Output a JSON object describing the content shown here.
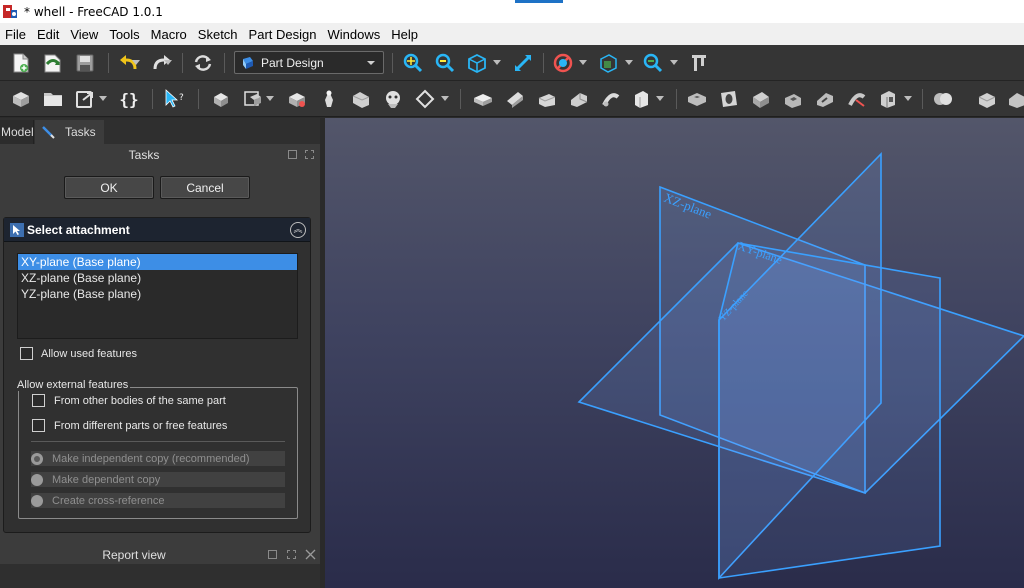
{
  "window": {
    "title": "* whell - FreeCAD 1.0.1"
  },
  "menu": [
    "File",
    "Edit",
    "View",
    "Tools",
    "Macro",
    "Sketch",
    "Part Design",
    "Windows",
    "Help"
  ],
  "toolbar": {
    "workbench_selected": "Part Design"
  },
  "tabs": {
    "model": "Model",
    "tasks": "Tasks"
  },
  "tasks_panel": {
    "title": "Tasks",
    "ok_label": "OK",
    "cancel_label": "Cancel",
    "attachment": {
      "title": "Select attachment",
      "references": [
        {
          "label": "XY-plane (Base plane)",
          "selected": true
        },
        {
          "label": "XZ-plane (Base plane)",
          "selected": false
        },
        {
          "label": "YZ-plane (Base plane)",
          "selected": false
        }
      ],
      "allow_used_features": "Allow used features",
      "external": {
        "title": "Allow external features",
        "from_other_bodies": "From other bodies of the same part",
        "from_different_parts": "From different parts or free features",
        "options": [
          {
            "label": "Make independent copy (recommended)",
            "checked": true
          },
          {
            "label": "Make dependent copy",
            "checked": false
          },
          {
            "label": "Create cross-reference",
            "checked": false
          }
        ]
      }
    }
  },
  "report_view": {
    "title": "Report view"
  },
  "viewport": {
    "plane_labels": {
      "xz": "XZ-plane",
      "xy": "XY-plane",
      "yz": "YZ-plane"
    },
    "plane_color": "#3aa0ff"
  }
}
